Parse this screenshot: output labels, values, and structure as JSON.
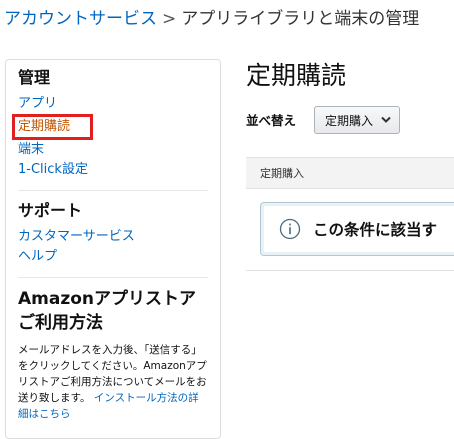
{
  "breadcrumb": {
    "parent": "アカウントサービス",
    "separator": ">",
    "current": "アプリライブラリと端末の管理"
  },
  "sidebar": {
    "manage": {
      "heading": "管理",
      "items": [
        {
          "label": "アプリ",
          "selected": false
        },
        {
          "label": "定期購読",
          "selected": true
        },
        {
          "label": "端末",
          "selected": false
        },
        {
          "label": "1-Click設定",
          "selected": false
        }
      ]
    },
    "support": {
      "heading": "サポート",
      "items": [
        {
          "label": "カスタマーサービス"
        },
        {
          "label": "ヘルプ"
        }
      ]
    },
    "appstore": {
      "heading_line1": "Amazonアプリストア",
      "heading_line2": "ご利用方法",
      "text": "メールアドレスを入力後、「送信する」をクリックしてください。Amazonアプリストアご利用方法についてメールをお送り致します。",
      "link": "インストール方法の詳細はこちら"
    }
  },
  "main": {
    "title": "定期購読",
    "sort_label": "並べ替え",
    "sort_value": "定期購入",
    "table_header": "定期購入",
    "info_message": "この条件に該当す"
  },
  "colors": {
    "link": "#0066c0",
    "selected": "#c45500",
    "highlight_border": "#e31e1e"
  }
}
